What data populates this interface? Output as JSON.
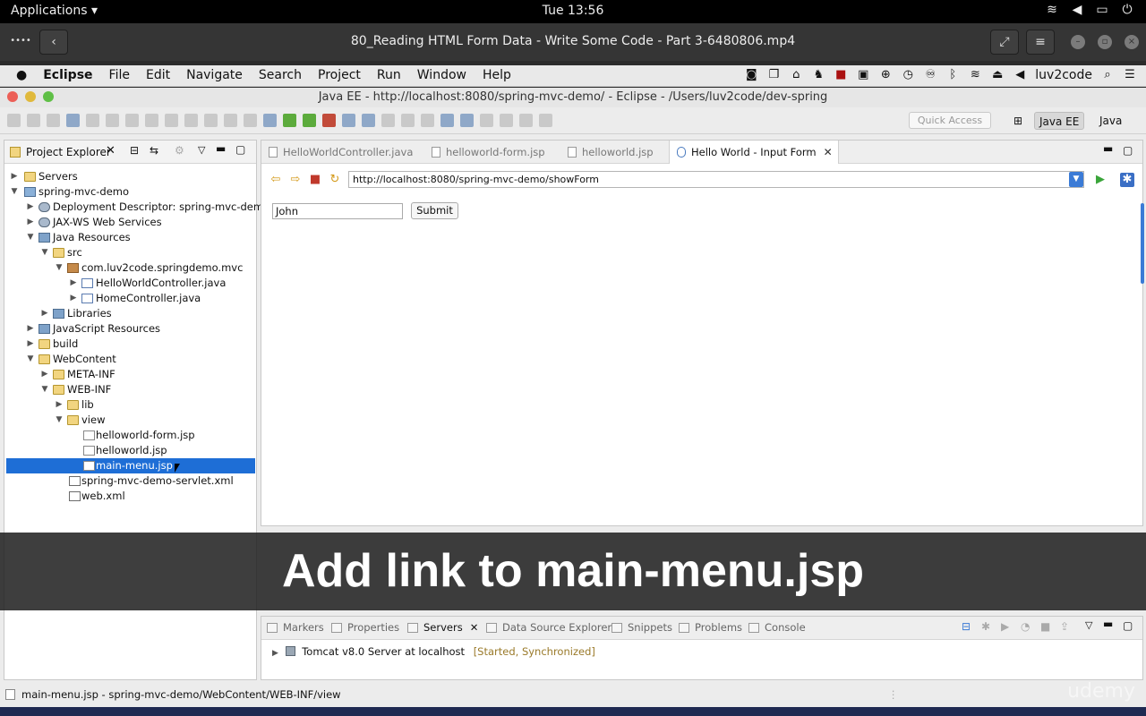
{
  "gnome": {
    "applications": "Applications ▾",
    "clock": "Tue 13:56"
  },
  "player": {
    "title": "80_Reading HTML Form Data - Write Some Code - Part 3-6480806.mp4"
  },
  "mac_menu": {
    "app_name": "Eclipse",
    "items": [
      "File",
      "Edit",
      "Navigate",
      "Search",
      "Project",
      "Run",
      "Window",
      "Help"
    ],
    "user": "luv2code"
  },
  "window": {
    "title": "Java EE - http://localhost:8080/spring-mvc-demo/ - Eclipse - /Users/luv2code/dev-spring"
  },
  "toolbar": {
    "quick_access": "Quick Access",
    "perspective_java_ee": "Java EE",
    "perspective_java": "Java"
  },
  "explorer": {
    "title": "Project Explorer",
    "tree": [
      {
        "label": "Servers",
        "icon": "folder-icon"
      },
      {
        "label": "spring-mvc-demo",
        "icon": "project-icon"
      },
      {
        "label": "Deployment Descriptor: spring-mvc-demo",
        "icon": "descriptor-icon"
      },
      {
        "label": "JAX-WS Web Services",
        "icon": "webservice-icon"
      },
      {
        "label": "Java Resources",
        "icon": "resources-icon"
      },
      {
        "label": "src",
        "icon": "folder-icon"
      },
      {
        "label": "com.luv2code.springdemo.mvc",
        "icon": "package-icon"
      },
      {
        "label": "HelloWorldController.java",
        "icon": "java-file-icon"
      },
      {
        "label": "HomeController.java",
        "icon": "java-file-icon"
      },
      {
        "label": "Libraries",
        "icon": "library-icon"
      },
      {
        "label": "JavaScript Resources",
        "icon": "js-resources-icon"
      },
      {
        "label": "build",
        "icon": "folder-icon"
      },
      {
        "label": "WebContent",
        "icon": "folder-icon"
      },
      {
        "label": "META-INF",
        "icon": "folder-icon"
      },
      {
        "label": "WEB-INF",
        "icon": "folder-icon"
      },
      {
        "label": "lib",
        "icon": "folder-icon"
      },
      {
        "label": "view",
        "icon": "folder-icon"
      },
      {
        "label": "helloworld-form.jsp",
        "icon": "jsp-file-icon"
      },
      {
        "label": "helloworld.jsp",
        "icon": "jsp-file-icon"
      },
      {
        "label": "main-menu.jsp",
        "icon": "jsp-file-icon"
      },
      {
        "label": "spring-mvc-demo-servlet.xml",
        "icon": "xml-file-icon"
      },
      {
        "label": "web.xml",
        "icon": "xml-file-icon"
      }
    ]
  },
  "editor": {
    "tabs": [
      "HelloWorldController.java",
      "helloworld-form.jsp",
      "helloworld.jsp",
      "Hello World - Input Form"
    ],
    "url": "http://localhost:8080/spring-mvc-demo/showForm",
    "input_value": "John",
    "submit_label": "Submit"
  },
  "bottom": {
    "tabs": [
      "Markers",
      "Properties",
      "Servers",
      "Data Source Explorer",
      "Snippets",
      "Problems",
      "Console"
    ],
    "server_name": "Tomcat v8.0 Server at localhost",
    "server_status": "[Started, Synchronized]"
  },
  "status_bar": {
    "text": "main-menu.jsp - spring-mvc-demo/WebContent/WEB-INF/view"
  },
  "caption": "Add link to main-menu.jsp",
  "watermark": "udemy",
  "colors": {
    "selection": "#1e6ed6",
    "caption_bg": "#1e1e1e"
  }
}
